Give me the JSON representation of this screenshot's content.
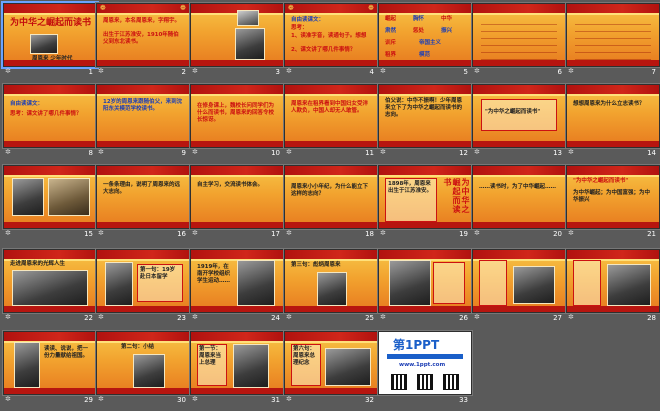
{
  "app": {
    "view": "slide-sorter"
  },
  "texts": {
    "s1_title": "为中华之崛起而读书",
    "s1_sub": "周恩来 少年时代",
    "s2_a": "周恩来，本名周恩来，字翔宇。",
    "s2_b": "出生于江苏淮安，1910年随伯父到东北读书。",
    "s4_a": "自由读课文：",
    "s4_b": "思考：",
    "s4_c": "1、读准字音，读通句子。想想",
    "s4_d": "2、课文讲了哪几件事情？",
    "s5_w": [
      "崛起",
      "胸怀",
      "中华",
      "肃然",
      "惩处",
      "振兴",
      "训斥",
      "帝国主义",
      "租界",
      "模范"
    ],
    "s8_a": "自由读课文：",
    "s8_b": "思考：课文讲了哪几件事情？",
    "s9_a": "12岁的周恩来跟随伯父，来到沈阳东关模范学校读书。",
    "s10_a": "在修身课上，魏校长问同学们为什么而读书，周恩来的回答令校长惊讶。",
    "s11_a": "周恩来在租界看到中国妇女受洋人欺负，中国人却无人敢管。",
    "s12_a": "伯父说：中华不振啊！少年周恩来立下了为中华之崛起而读书的志向。",
    "s13_a": "\"为中华之崛起而读书\"",
    "s14_a": "想想周恩来为什么立志读书？",
    "s16_a": "一条条理由，说明了周恩来的远大志向。",
    "s17_a": "自主学习，交流读书体会。",
    "s18_a": "周恩来小小年纪，为什么能立下这样的志向？",
    "s19_a": "1898年，周恩来出生于江苏淮安。",
    "s20_vert": "为中华之崛起而读书",
    "s21_a": "……读书时，为了中华崛起……",
    "s22_a": "\"为中华之崛起而读书\"",
    "s22_b": "为中华崛起；为中国富强；为中华振兴",
    "s23_a": "走进周恩来的光辉人生",
    "s24_a": "第一句：19岁赴日本留学",
    "s25_a": "1919年，在南开学校组织学生运动……",
    "s26_a": "第三句：彪炳周恩来",
    "s29_a": "读读、说说，把一份力量献给祖国。",
    "s31_a": "第二句：小结",
    "s32_a": "第一节：周恩来当上总理",
    "s33_a": "第六句：周恩来总理纪念",
    "s34_logo": "第1PPT",
    "s34_sub": "www.1ppt.com"
  },
  "slides": [
    {
      "n": "1"
    },
    {
      "n": "2"
    },
    {
      "n": "3"
    },
    {
      "n": "4"
    },
    {
      "n": "5"
    },
    {
      "n": "6"
    },
    {
      "n": "7"
    },
    {
      "n": "8"
    },
    {
      "n": "9"
    },
    {
      "n": "10"
    },
    {
      "n": "11"
    },
    {
      "n": "12"
    },
    {
      "n": "13"
    },
    {
      "n": "14"
    },
    {
      "n": "15"
    },
    {
      "n": "16"
    },
    {
      "n": "17"
    },
    {
      "n": "18"
    },
    {
      "n": "19"
    },
    {
      "n": "20"
    },
    {
      "n": "21"
    },
    {
      "n": "22"
    },
    {
      "n": "23"
    },
    {
      "n": "24"
    },
    {
      "n": "25"
    },
    {
      "n": "26"
    },
    {
      "n": "27"
    },
    {
      "n": "28"
    },
    {
      "n": "29"
    },
    {
      "n": "30"
    },
    {
      "n": "31"
    },
    {
      "n": "32"
    },
    {
      "n": "33"
    }
  ],
  "colors": {
    "background": "#5a5a5a",
    "accent_red": "#cc1111",
    "accent_blue": "#1e3fb5",
    "selection": "#6aa3ff"
  },
  "icons": {
    "slide_marker": "star-icon",
    "lantern": "lantern-icon"
  }
}
